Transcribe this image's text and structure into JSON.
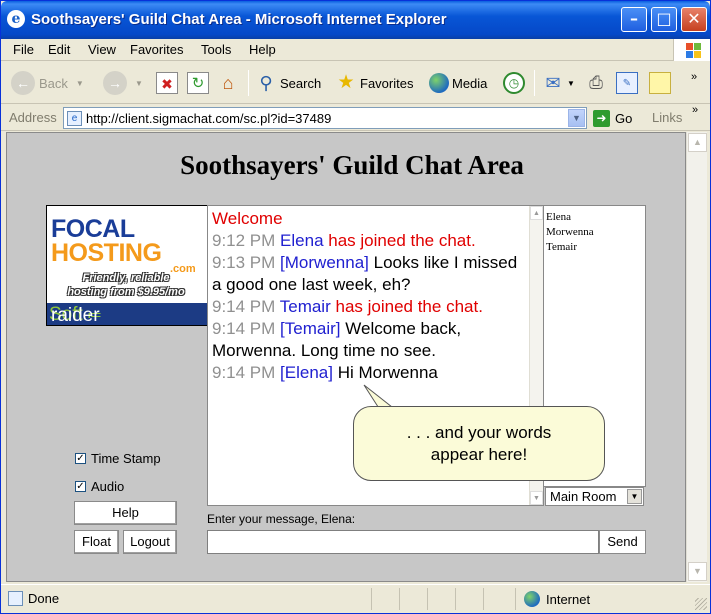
{
  "window": {
    "title": "Soothsayers' Guild Chat Area - Microsoft Internet Explorer"
  },
  "menu": [
    "File",
    "Edit",
    "View",
    "Favorites",
    "Tools",
    "Help"
  ],
  "toolbar": {
    "back": "Back",
    "search": "Search",
    "favorites": "Favorites",
    "media": "Media"
  },
  "address": {
    "label": "Address",
    "url": "http://client.sigmachat.com/sc.pl?id=37489",
    "go": "Go",
    "links": "Links"
  },
  "page": {
    "title": "Soothsayers' Guild Chat Area",
    "ad": {
      "focal": "FOCAL",
      "hosting": "HOSTING",
      "dotcom": ".com",
      "tagline_1": "Friendly, reliable",
      "tagline_2": "hosting from $9.95/mo",
      "brand_1": "raider",
      "brand_2": "Soft"
    },
    "options": {
      "timestamp": "Time Stamp",
      "audio": "Audio",
      "timestamp_checked": true,
      "audio_checked": true
    },
    "buttons": {
      "help": "Help",
      "float": "Float",
      "logout": "Logout",
      "send": "Send"
    },
    "chat": {
      "welcome": "Welcome",
      "messages": [
        {
          "time": "9:12 PM",
          "name": "Elena",
          "text": "has joined the chat.",
          "system": true
        },
        {
          "time": "9:13 PM",
          "name": "[Morwenna]",
          "text": "Looks like I missed a good one last week, eh?",
          "system": false
        },
        {
          "time": "9:14 PM",
          "name": "Temair",
          "text": "has joined the chat.",
          "system": true
        },
        {
          "time": "9:14 PM",
          "name": "[Temair]",
          "text": "Welcome back, Morwenna. Long time no see.",
          "system": false
        },
        {
          "time": "9:14 PM",
          "name": "[Elena]",
          "text": "Hi Morwenna",
          "system": false
        }
      ]
    },
    "users": [
      "Elena",
      "Morwenna",
      "Temair"
    ],
    "room": "Main Room",
    "bubble": {
      "line1": ". . . and your words",
      "line2": "appear here!"
    },
    "prompt": "Enter your message, Elena:",
    "message_value": ""
  },
  "status": {
    "left": "Done",
    "zone": "Internet"
  },
  "colors": {
    "timestamp": "#909090",
    "name": "#2020d0",
    "system": "#e00000",
    "title_bar": "#0856d6"
  }
}
